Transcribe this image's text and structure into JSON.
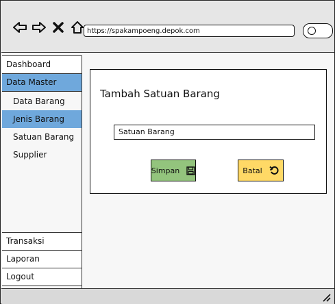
{
  "browser": {
    "url": "https://spakampoeng.depok.com"
  },
  "sidebar": {
    "dashboard": "Dashboard",
    "data_master": "Data Master",
    "sub_items": [
      {
        "label": "Data Barang"
      },
      {
        "label": "Jenis Barang"
      },
      {
        "label": "Satuan Barang"
      },
      {
        "label": "Supplier"
      }
    ],
    "bottom_items": [
      {
        "label": "Transaksi"
      },
      {
        "label": "Laporan"
      },
      {
        "label": "Logout"
      }
    ]
  },
  "main": {
    "title": "Tambah Satuan Barang",
    "field_value": "Satuan Barang",
    "save_label": "Simpan",
    "cancel_label": "Batal"
  },
  "colors": {
    "active_menu": "#6fa8dc",
    "save_button": "#93c47d",
    "cancel_button": "#ffd966"
  },
  "icons": {
    "back": "arrow-left-icon",
    "forward": "arrow-right-icon",
    "close": "close-icon",
    "home": "home-icon",
    "search": "search-icon",
    "save": "floppy-disk-icon",
    "cancel": "undo-icon"
  }
}
